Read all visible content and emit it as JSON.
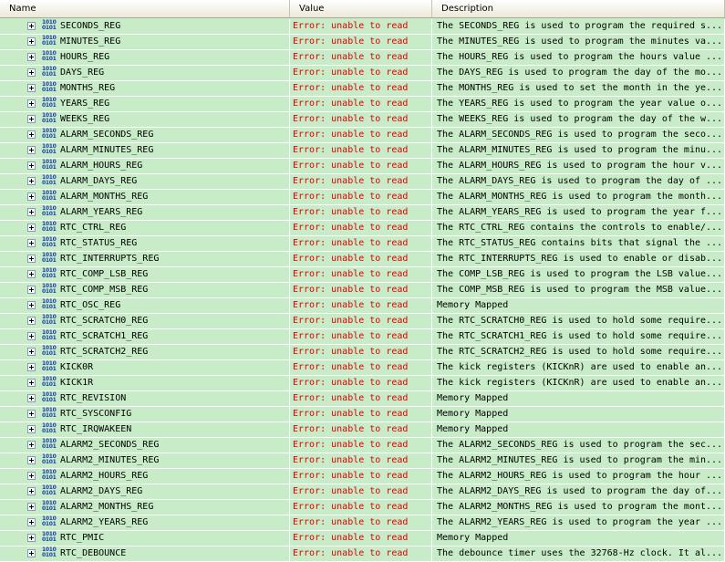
{
  "columns": {
    "name": "Name",
    "value": "Value",
    "description": "Description"
  },
  "icon": {
    "top": "1010",
    "bottom": "0101",
    "name": "binary-register-icon"
  },
  "rows": [
    {
      "name": "SECONDS_REG",
      "value": "Error: unable to read",
      "desc": "The SECONDS_REG is used to program the required s..."
    },
    {
      "name": "MINUTES_REG",
      "value": "Error: unable to read",
      "desc": "The MINUTES_REG is used to program the minutes va..."
    },
    {
      "name": "HOURS_REG",
      "value": "Error: unable to read",
      "desc": "The HOURS_REG is used to program the hours value ..."
    },
    {
      "name": "DAYS_REG",
      "value": "Error: unable to read",
      "desc": "The DAYS_REG is used to program the day of the mo..."
    },
    {
      "name": "MONTHS_REG",
      "value": "Error: unable to read",
      "desc": "The MONTHS_REG is used to set the month in the ye..."
    },
    {
      "name": "YEARS_REG",
      "value": "Error: unable to read",
      "desc": "The YEARS_REG is used to program the year value o..."
    },
    {
      "name": "WEEKS_REG",
      "value": "Error: unable to read",
      "desc": "The WEEKS_REG is used to program the day of the w..."
    },
    {
      "name": "ALARM_SECONDS_REG",
      "value": "Error: unable to read",
      "desc": "The ALARM_SECONDS_REG is used to program the seco..."
    },
    {
      "name": "ALARM_MINUTES_REG",
      "value": "Error: unable to read",
      "desc": "The ALARM_MINUTES_REG is used to program the minu..."
    },
    {
      "name": "ALARM_HOURS_REG",
      "value": "Error: unable to read",
      "desc": "The ALARM_HOURS_REG is used to program the hour v..."
    },
    {
      "name": "ALARM_DAYS_REG",
      "value": "Error: unable to read",
      "desc": "The ALARM_DAYS_REG is used to program the day of ..."
    },
    {
      "name": "ALARM_MONTHS_REG",
      "value": "Error: unable to read",
      "desc": "The ALARM_MONTHS_REG is used to program the month..."
    },
    {
      "name": "ALARM_YEARS_REG",
      "value": "Error: unable to read",
      "desc": "The ALARM_YEARS_REG is used to program the year f..."
    },
    {
      "name": "RTC_CTRL_REG",
      "value": "Error: unable to read",
      "desc": "The RTC_CTRL_REG contains the controls to enable/..."
    },
    {
      "name": "RTC_STATUS_REG",
      "value": "Error: unable to read",
      "desc": "The RTC_STATUS_REG contains bits that signal the ..."
    },
    {
      "name": "RTC_INTERRUPTS_REG",
      "value": "Error: unable to read",
      "desc": "The RTC_INTERRUPTS_REG is used to enable or disab..."
    },
    {
      "name": "RTC_COMP_LSB_REG",
      "value": "Error: unable to read",
      "desc": "The COMP_LSB_REG is used to program the LSB value..."
    },
    {
      "name": "RTC_COMP_MSB_REG",
      "value": "Error: unable to read",
      "desc": "The COMP_MSB_REG is used to program the MSB value..."
    },
    {
      "name": "RTC_OSC_REG",
      "value": "Error: unable to read",
      "desc": "Memory Mapped"
    },
    {
      "name": "RTC_SCRATCH0_REG",
      "value": "Error: unable to read",
      "desc": "The RTC_SCRATCH0_REG is used to hold some require..."
    },
    {
      "name": "RTC_SCRATCH1_REG",
      "value": "Error: unable to read",
      "desc": "The RTC_SCRATCH1_REG is used to hold some require..."
    },
    {
      "name": "RTC_SCRATCH2_REG",
      "value": "Error: unable to read",
      "desc": "The RTC_SCRATCH2_REG is used to hold some require..."
    },
    {
      "name": "KICK0R",
      "value": "Error: unable to read",
      "desc": "The kick registers (KICKnR) are used to enable an..."
    },
    {
      "name": "KICK1R",
      "value": "Error: unable to read",
      "desc": "The kick registers (KICKnR) are used to enable an..."
    },
    {
      "name": "RTC_REVISION",
      "value": "Error: unable to read",
      "desc": "Memory Mapped"
    },
    {
      "name": "RTC_SYSCONFIG",
      "value": "Error: unable to read",
      "desc": "Memory Mapped"
    },
    {
      "name": "RTC_IRQWAKEEN",
      "value": "Error: unable to read",
      "desc": "Memory Mapped"
    },
    {
      "name": "ALARM2_SECONDS_REG",
      "value": "Error: unable to read",
      "desc": "The ALARM2_SECONDS_REG is used to program the sec..."
    },
    {
      "name": "ALARM2_MINUTES_REG",
      "value": "Error: unable to read",
      "desc": "The ALARM2_MINUTES_REG is used to program the min..."
    },
    {
      "name": "ALARM2_HOURS_REG",
      "value": "Error: unable to read",
      "desc": "The ALARM2_HOURS_REG is used to program the hour ..."
    },
    {
      "name": "ALARM2_DAYS_REG",
      "value": "Error: unable to read",
      "desc": "The ALARM2_DAYS_REG is used to program the day of..."
    },
    {
      "name": "ALARM2_MONTHS_REG",
      "value": "Error: unable to read",
      "desc": "The ALARM2_MONTHS_REG is used to program the mont..."
    },
    {
      "name": "ALARM2_YEARS_REG",
      "value": "Error: unable to read",
      "desc": "The ALARM2_YEARS_REG is used to program the year ..."
    },
    {
      "name": "RTC_PMIC",
      "value": "Error: unable to read",
      "desc": "Memory Mapped"
    },
    {
      "name": "RTC_DEBOUNCE",
      "value": "Error: unable to read",
      "desc": "The debounce timer uses the 32768-Hz clock. It al..."
    }
  ]
}
